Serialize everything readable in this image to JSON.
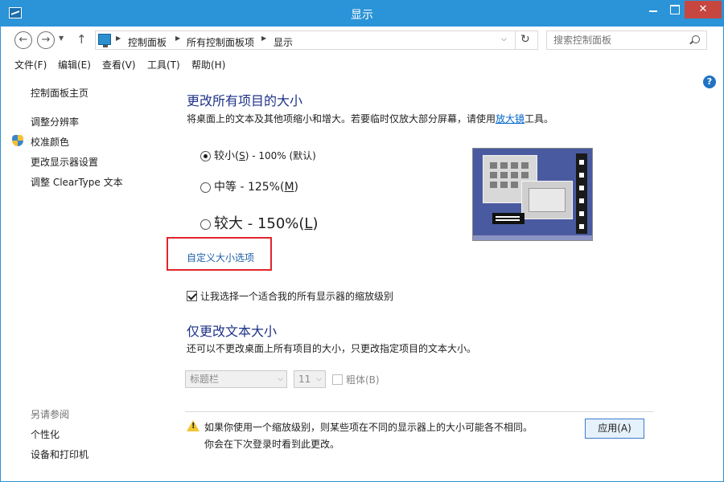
{
  "window": {
    "title": "显示",
    "close_glyph": "✕"
  },
  "nav": {
    "back_glyph": "←",
    "forward_glyph": "→",
    "dropdown_glyph": "▼",
    "up_glyph": "↑",
    "breadcrumb_sep": "▶",
    "breadcrumb": [
      "控制面板",
      "所有控制面板项",
      "显示"
    ],
    "address_dropdown_glyph": "⌵",
    "refresh_glyph": "↻",
    "search_placeholder": "搜索控制面板"
  },
  "menu": [
    "文件(F)",
    "编辑(E)",
    "查看(V)",
    "工具(T)",
    "帮助(H)"
  ],
  "left_panel": {
    "home": "控制面板主页",
    "links": [
      "调整分辨率",
      "校准颜色",
      "更改显示器设置",
      "调整 ClearType 文本"
    ],
    "see_also": "另请参阅",
    "see_also_links": [
      "个性化",
      "设备和打印机"
    ]
  },
  "help_glyph": "?",
  "section1": {
    "title": "更改所有项目的大小",
    "desc_before": "将桌面上的文本及其他项缩小和增大。若要临时仅放大部分屏幕，请使用",
    "desc_link": "放大镜",
    "desc_after": "工具。"
  },
  "options": [
    {
      "label": "较小(",
      "key": "S",
      "suffix": ") - 100% (默认)",
      "selected": true
    },
    {
      "label": "中等 - 125%(",
      "key": "M",
      "suffix": ")",
      "selected": false
    },
    {
      "label": "较大 - 150%(",
      "key": "L",
      "suffix": ")",
      "selected": false
    }
  ],
  "custom_link": "自定义大小选项",
  "checkbox_label": "让我选择一个适合我的所有显示器的缩放级别",
  "checkbox_checked": true,
  "section2": {
    "title": "仅更改文本大小",
    "desc": "还可以不更改桌面上所有项目的大小，只更改指定项目的文本大小。"
  },
  "text_controls": {
    "element_value": "标题栏",
    "size_value": "11",
    "bold_label": "粗体(B)",
    "select_arrow": "⌵"
  },
  "warning": {
    "line1": "如果你使用一个缩放级别，则某些项在不同的显示器上的大小可能各不相同。",
    "line2": "你会在下次登录时看到此更改。"
  },
  "apply_label": "应用(A)"
}
